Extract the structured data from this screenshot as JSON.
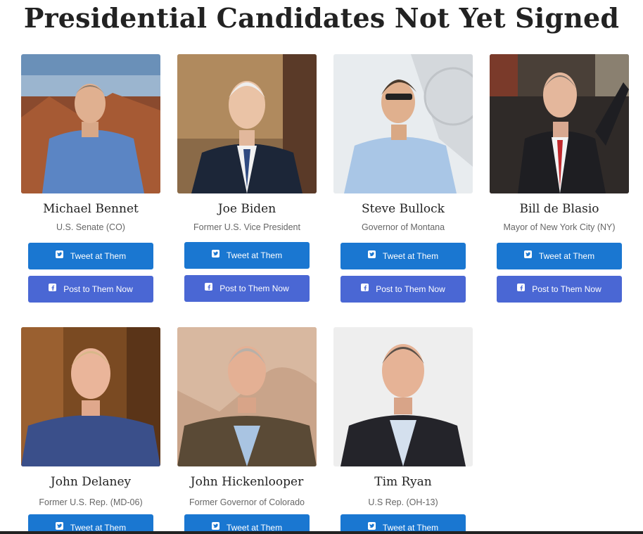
{
  "page": {
    "title": "Presidential Candidates Not Yet Signed"
  },
  "buttons": {
    "tweet_label": "Tweet at Them",
    "post_label": "Post to Them Now"
  },
  "colors": {
    "tweet": "#1a77d1",
    "post": "#4a67d4"
  },
  "candidates": [
    {
      "name": "Michael Bennet",
      "role": "U.S. Senate (CO)"
    },
    {
      "name": "Joe Biden",
      "role": "Former U.S. Vice President"
    },
    {
      "name": "Steve Bullock",
      "role": "Governor of Montana"
    },
    {
      "name": "Bill de Blasio",
      "role": "Mayor of New York City (NY)"
    },
    {
      "name": "John Delaney",
      "role": "Former U.S. Rep. (MD-06)"
    },
    {
      "name": "John Hickenlooper",
      "role": "Former Governor of Colorado"
    },
    {
      "name": "Tim Ryan",
      "role": "U.S Rep. (OH-13)"
    }
  ]
}
